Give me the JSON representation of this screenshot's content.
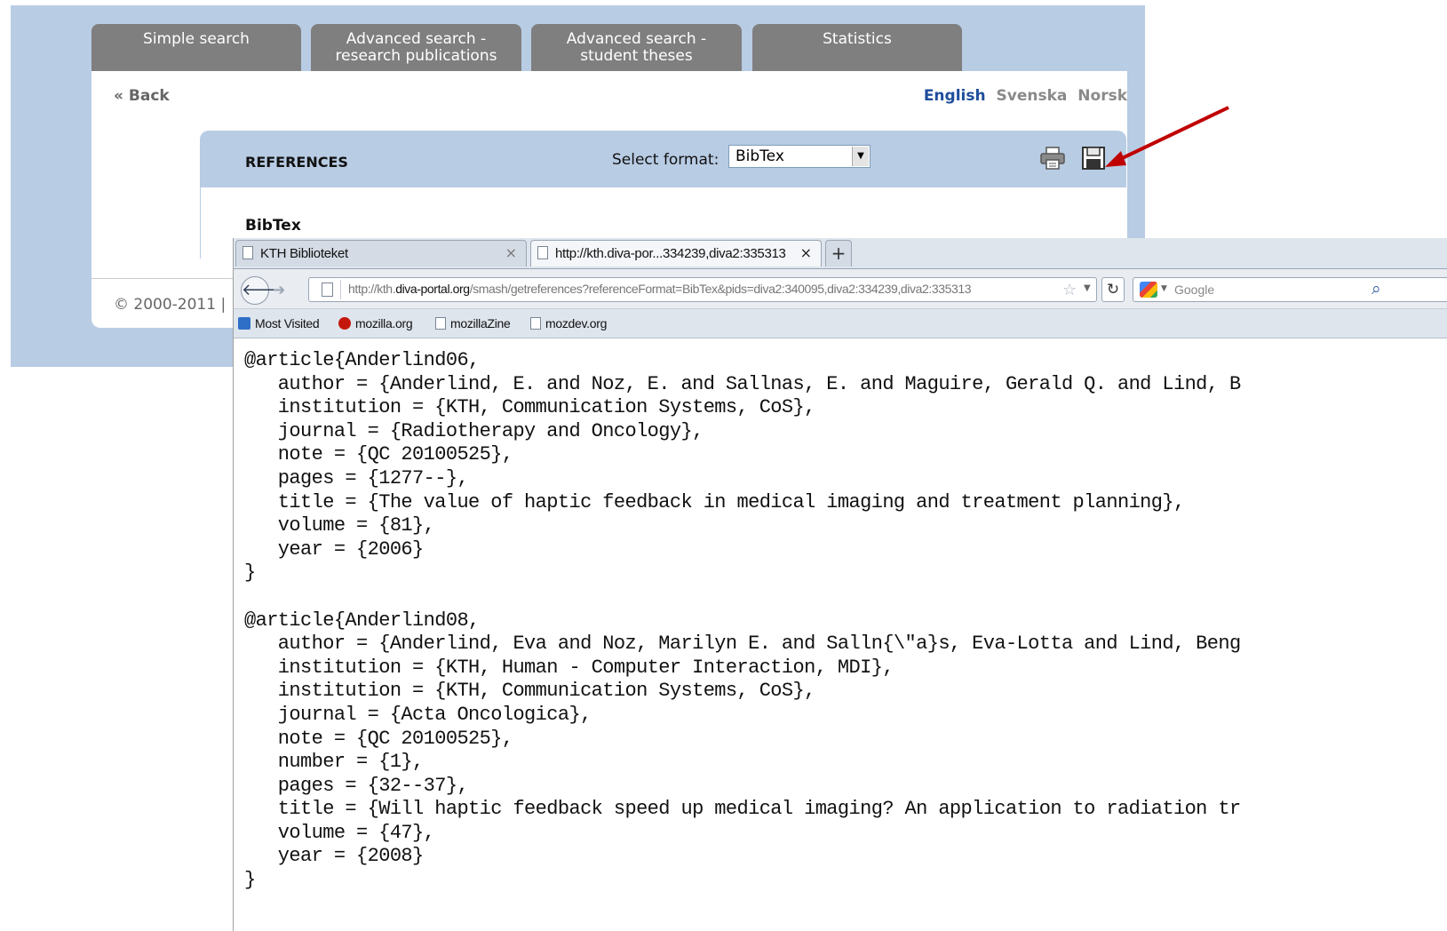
{
  "diva": {
    "tabs": [
      {
        "label": "Simple search"
      },
      {
        "label": "Advanced search -\nresearch publications"
      },
      {
        "label": "Advanced search -\nstudent theses"
      },
      {
        "label": "Statistics"
      }
    ],
    "back_label": "« Back",
    "languages": [
      "English",
      "Svenska",
      "Norsk"
    ],
    "references_title": "REFERENCES",
    "select_format_label": "Select format:",
    "selected_format": "BibTex",
    "bibtex_heading": "BibTex",
    "copyright": "© 2000-2011 |",
    "colors": {
      "header_bg": "#b8cce4",
      "tab_bg": "#7f7f7f",
      "link_active": "#1f4e9c",
      "arrow": "#c00000"
    },
    "icons": [
      "print-icon",
      "save-icon",
      "dropdown-arrow-icon"
    ]
  },
  "browser": {
    "tabs": [
      {
        "label": "KTH Biblioteket",
        "close": "×"
      },
      {
        "label": "http://kth.diva-por...334239,diva2:335313",
        "close": "×"
      }
    ],
    "new_tab_label": "+",
    "url": {
      "prefix": "http://kth.",
      "domain": "diva-portal.org",
      "path": "/smash/getreferences?referenceFormat=BibTex&pids=diva2:340095,diva2:334239,diva2:335313"
    },
    "search_placeholder": "Google",
    "bookmarks": [
      "Most Visited",
      "mozilla.org",
      "mozillaZine",
      "mozdev.org"
    ],
    "icons": [
      "back-arrow-icon",
      "forward-arrow-icon",
      "page-icon",
      "star-icon",
      "reload-icon",
      "google-icon",
      "magnifier-icon"
    ]
  },
  "bibtex_text": "@article{Anderlind06,\n   author = {Anderlind, E. and Noz, E. and Sallnas, E. and Maguire, Gerald Q. and Lind, B\n   institution = {KTH, Communication Systems, CoS},\n   journal = {Radiotherapy and Oncology},\n   note = {QC 20100525},\n   pages = {1277--},\n   title = {The value of haptic feedback in medical imaging and treatment planning},\n   volume = {81},\n   year = {2006}\n}\n\n@article{Anderlind08,\n   author = {Anderlind, Eva and Noz, Marilyn E. and Salln{\\\"a}s, Eva-Lotta and Lind, Beng\n   institution = {KTH, Human - Computer Interaction, MDI},\n   institution = {KTH, Communication Systems, CoS},\n   journal = {Acta Oncologica},\n   note = {QC 20100525},\n   number = {1},\n   pages = {32--37},\n   title = {Will haptic feedback speed up medical imaging? An application to radiation tr\n   volume = {47},\n   year = {2008}\n}"
}
